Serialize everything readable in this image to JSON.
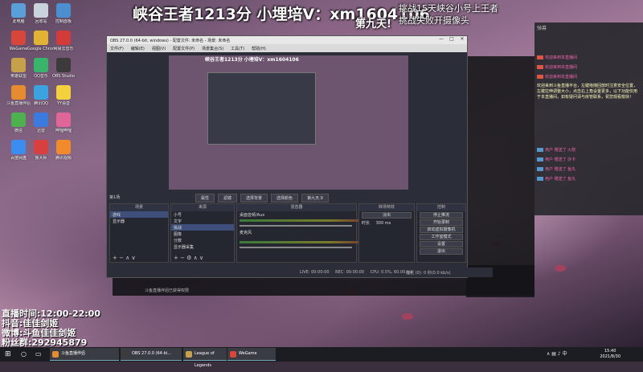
{
  "overlay": {
    "title": "峡谷王者1213分 小埋培V：xm1604106",
    "day": "第九天!",
    "challenge_1": "挑战15天峡谷小号上王者",
    "challenge_2": "挑战失败开摄像头"
  },
  "bottom_info": {
    "live_time": "直播时间:12:00-22:00",
    "douyin": "抖音:佳佳剑姬",
    "weibo": "微博:斗鱼佳佳剑姬",
    "fans_group": "粉丝群:292945879"
  },
  "desktop_icons": [
    {
      "label": "此电脑",
      "color": "#5aa0d8"
    },
    {
      "label": "回收站",
      "color": "#c9d3dc"
    },
    {
      "label": "控制面板",
      "color": "#4b8fd1"
    },
    {
      "label": "WeGame",
      "color": "#d8453a"
    },
    {
      "label": "Google Chrome",
      "color": "#e2b233"
    },
    {
      "label": "网易云音乐",
      "color": "#d33a3a"
    },
    {
      "label": "英雄联盟",
      "color": "#c7a04a"
    },
    {
      "label": "QQ音乐",
      "color": "#39b56b"
    },
    {
      "label": "OBS Studio",
      "color": "#3b3b3b"
    },
    {
      "label": "斗鱼直播伴侣",
      "color": "#e48c2f"
    },
    {
      "label": "腾讯QQ",
      "color": "#3aa3e0"
    },
    {
      "label": "YY语音",
      "color": "#f2d13c"
    },
    {
      "label": "微信",
      "color": "#4db14f"
    },
    {
      "label": "迅雷",
      "color": "#3b7be0"
    },
    {
      "label": "哔哩哔哩",
      "color": "#e0669a"
    },
    {
      "label": "百度网盘",
      "color": "#3c8df0"
    },
    {
      "label": "鲁大师",
      "color": "#d84040"
    },
    {
      "label": "腾讯视频",
      "color": "#f08a2a"
    }
  ],
  "chat": {
    "header": "弹幕",
    "messages": [
      {
        "text": "欢迎来到本直播间"
      },
      {
        "text": "欢迎来到本直播间"
      },
      {
        "text": "欢迎来到本直播间"
      }
    ],
    "system": "欢迎来到斗鱼直播平台，左键拖拽回放时注意安全位置，左键拉伸调整大小，点击右上角设置更多，以下功能仅用于本直播间，如有疑问请与房管联系，祝您观看愉快！",
    "gifts": [
      {
        "text": "用户 赠送了 火箭"
      },
      {
        "text": "用户 赠送了 办卡"
      },
      {
        "text": "用户 赠送了 鱼丸"
      },
      {
        "text": "用户 赠送了 鱼丸"
      }
    ]
  },
  "obs": {
    "title": "OBS 27.0.0 (64-bit, windows) - 配置文件: 未命名 - 场景: 未命名",
    "menu": [
      "文件(F)",
      "编辑(E)",
      "视图(V)",
      "配置文件(P)",
      "场景集合(S)",
      "工具(T)",
      "帮助(H)"
    ],
    "preview_title": "峡谷王者1213分 小埋培V：xm1604106",
    "scene_label": "第1场",
    "toolbar": [
      "属性",
      "滤镜",
      "选择背景",
      "选择颜色",
      "第九天.9"
    ],
    "scenes_header": "场景",
    "scenes": [
      "游戏",
      "显示器"
    ],
    "sources_header": "来源",
    "sources": [
      "小号",
      "文字",
      "挑战",
      "图像",
      "分数",
      "显示器采集"
    ],
    "mixer_header": "混音器",
    "mixer_tracks": [
      {
        "name": "桌面音频/Aux",
        "db": "0.0 dB"
      },
      {
        "name": "麦克风",
        "db": "0.0 dB"
      }
    ],
    "transitions_header": "转场特效",
    "transition_type": "淡出",
    "transition_duration_label": "时长",
    "transition_duration": "300 ms",
    "controls_header": "控制",
    "controls": [
      "停止推流",
      "开始录制",
      "启动虚拟摄像机",
      "工作室模式",
      "设置",
      "退出"
    ],
    "status": {
      "live": "LIVE: 00:00:00",
      "rec": "REC: 00:00:00",
      "cpu": "CPU: 0.5%, 60.00 fps",
      "extra": "延迟 (0): 0 秒(0.0 kb/s)"
    }
  },
  "client": {
    "hint": "斗鱼直播伴侣已获得权限"
  },
  "taskbar": {
    "apps": [
      {
        "label": "斗鱼直播伴侣",
        "color": "#e48c2f"
      },
      {
        "label": "OBS 27.0.0 (64-bi...",
        "color": "#3b3b3b"
      },
      {
        "label": "League of Legends",
        "color": "#c7a04a"
      },
      {
        "label": "WeGame",
        "color": "#d8453a"
      }
    ],
    "time": "15:40",
    "date": "2021/8/30"
  }
}
